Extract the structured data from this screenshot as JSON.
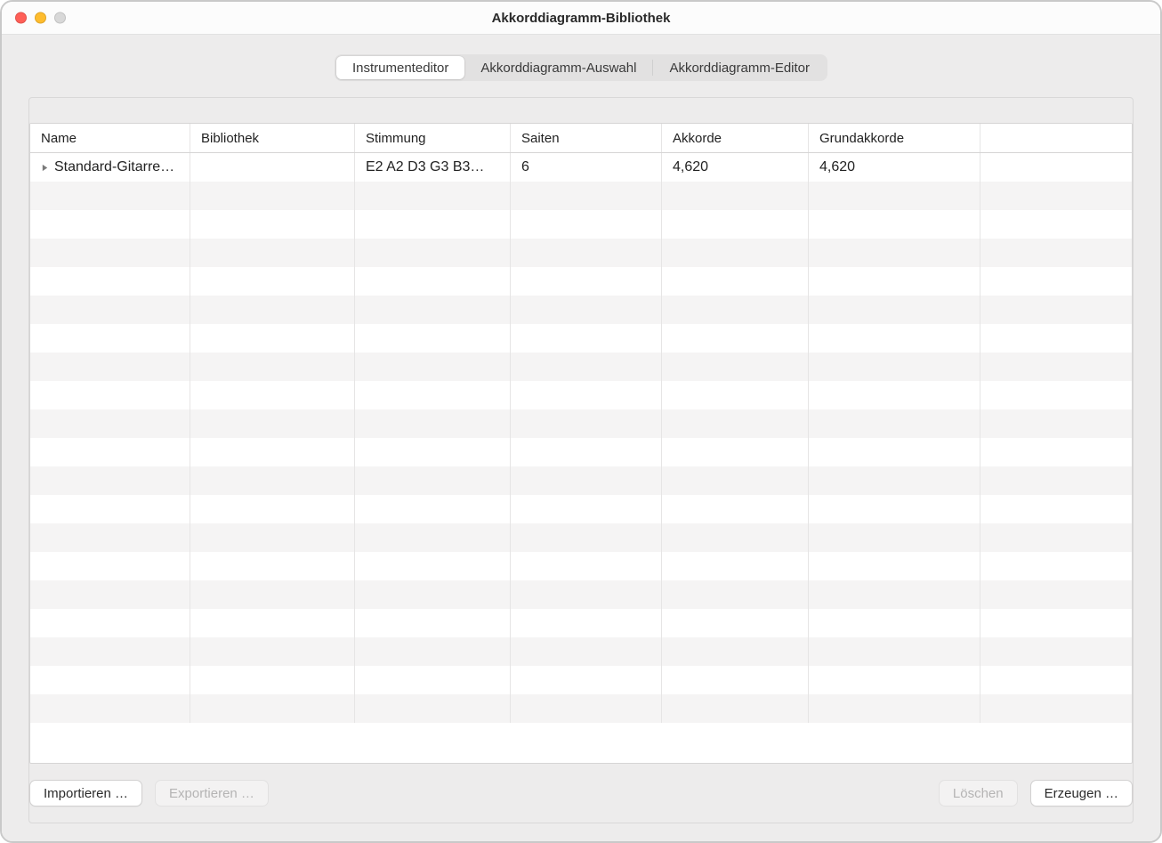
{
  "window": {
    "title": "Akkorddiagramm-Bibliothek"
  },
  "tabs": {
    "items": [
      {
        "label": "Instrumenteditor"
      },
      {
        "label": "Akkorddiagramm-Auswahl"
      },
      {
        "label": "Akkorddiagramm-Editor"
      }
    ],
    "active_index": 0
  },
  "table": {
    "columns": [
      {
        "label": "Name"
      },
      {
        "label": "Bibliothek"
      },
      {
        "label": "Stimmung"
      },
      {
        "label": "Saiten"
      },
      {
        "label": "Akkorde"
      },
      {
        "label": "Grundakkorde"
      }
    ],
    "rows": [
      {
        "name": "Standard-Gitarre…",
        "library": "",
        "tuning": "E2 A2 D3 G3 B3…",
        "strings": "6",
        "chords": "4,620",
        "root_chords": "4,620"
      }
    ],
    "visible_row_count": 20
  },
  "footer": {
    "import": "Importieren …",
    "export": "Exportieren …",
    "delete": "Löschen",
    "create": "Erzeugen …"
  }
}
